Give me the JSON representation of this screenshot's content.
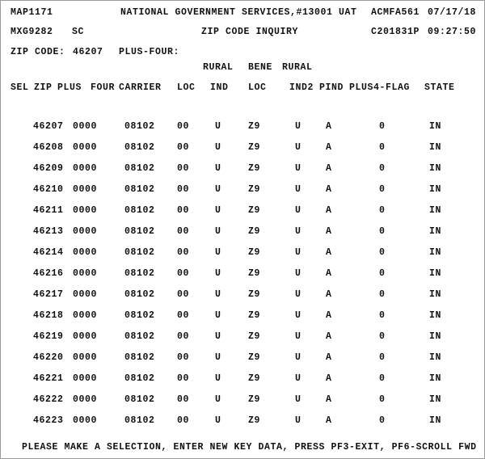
{
  "header": {
    "map_id": "MAP1171",
    "center_title": "NATIONAL GOVERNMENT SERVICES,#13001 UAT",
    "program_id": "ACMFA561",
    "run_date": "07/17/18",
    "txn_id": "MXG9282",
    "region_code": "SC",
    "screen_title": "ZIP CODE INQUIRY",
    "terminal_id": "C201831P",
    "run_time": "09:27:50"
  },
  "key_fields": {
    "zip_label": "ZIP CODE:",
    "zip_value": "46207",
    "plusfour_label": "PLUS-FOUR:",
    "plusfour_value": ""
  },
  "column_headers": {
    "top_line": {
      "rural_1": "RURAL",
      "bene": "BENE",
      "rural_2": "RURAL"
    },
    "main_line": {
      "sel": "SEL",
      "zip": "ZIP",
      "plus": "PLUS",
      "four": "FOUR",
      "carrier": "CARRIER",
      "loc": "LOC",
      "rural_ind": "IND",
      "bene_loc": "LOC",
      "rural_ind2": "IND2",
      "pind": "PIND",
      "plus4_flag": "PLUS4-FLAG",
      "state": "STATE"
    }
  },
  "rows": [
    {
      "sel": "",
      "zip": "46207",
      "plus": "0000",
      "four": "",
      "carrier": "08102",
      "loc": "00",
      "rural_ind": "U",
      "bene_loc": "Z9",
      "rural_ind2": "U",
      "pind": "A",
      "plus4_flag": "0",
      "state": "IN"
    },
    {
      "sel": "",
      "zip": "46208",
      "plus": "0000",
      "four": "",
      "carrier": "08102",
      "loc": "00",
      "rural_ind": "U",
      "bene_loc": "Z9",
      "rural_ind2": "U",
      "pind": "A",
      "plus4_flag": "0",
      "state": "IN"
    },
    {
      "sel": "",
      "zip": "46209",
      "plus": "0000",
      "four": "",
      "carrier": "08102",
      "loc": "00",
      "rural_ind": "U",
      "bene_loc": "Z9",
      "rural_ind2": "U",
      "pind": "A",
      "plus4_flag": "0",
      "state": "IN"
    },
    {
      "sel": "",
      "zip": "46210",
      "plus": "0000",
      "four": "",
      "carrier": "08102",
      "loc": "00",
      "rural_ind": "U",
      "bene_loc": "Z9",
      "rural_ind2": "U",
      "pind": "A",
      "plus4_flag": "0",
      "state": "IN"
    },
    {
      "sel": "",
      "zip": "46211",
      "plus": "0000",
      "four": "",
      "carrier": "08102",
      "loc": "00",
      "rural_ind": "U",
      "bene_loc": "Z9",
      "rural_ind2": "U",
      "pind": "A",
      "plus4_flag": "0",
      "state": "IN"
    },
    {
      "sel": "",
      "zip": "46213",
      "plus": "0000",
      "four": "",
      "carrier": "08102",
      "loc": "00",
      "rural_ind": "U",
      "bene_loc": "Z9",
      "rural_ind2": "U",
      "pind": "A",
      "plus4_flag": "0",
      "state": "IN"
    },
    {
      "sel": "",
      "zip": "46214",
      "plus": "0000",
      "four": "",
      "carrier": "08102",
      "loc": "00",
      "rural_ind": "U",
      "bene_loc": "Z9",
      "rural_ind2": "U",
      "pind": "A",
      "plus4_flag": "0",
      "state": "IN"
    },
    {
      "sel": "",
      "zip": "46216",
      "plus": "0000",
      "four": "",
      "carrier": "08102",
      "loc": "00",
      "rural_ind": "U",
      "bene_loc": "Z9",
      "rural_ind2": "U",
      "pind": "A",
      "plus4_flag": "0",
      "state": "IN"
    },
    {
      "sel": "",
      "zip": "46217",
      "plus": "0000",
      "four": "",
      "carrier": "08102",
      "loc": "00",
      "rural_ind": "U",
      "bene_loc": "Z9",
      "rural_ind2": "U",
      "pind": "A",
      "plus4_flag": "0",
      "state": "IN"
    },
    {
      "sel": "",
      "zip": "46218",
      "plus": "0000",
      "four": "",
      "carrier": "08102",
      "loc": "00",
      "rural_ind": "U",
      "bene_loc": "Z9",
      "rural_ind2": "U",
      "pind": "A",
      "plus4_flag": "0",
      "state": "IN"
    },
    {
      "sel": "",
      "zip": "46219",
      "plus": "0000",
      "four": "",
      "carrier": "08102",
      "loc": "00",
      "rural_ind": "U",
      "bene_loc": "Z9",
      "rural_ind2": "U",
      "pind": "A",
      "plus4_flag": "0",
      "state": "IN"
    },
    {
      "sel": "",
      "zip": "46220",
      "plus": "0000",
      "four": "",
      "carrier": "08102",
      "loc": "00",
      "rural_ind": "U",
      "bene_loc": "Z9",
      "rural_ind2": "U",
      "pind": "A",
      "plus4_flag": "0",
      "state": "IN"
    },
    {
      "sel": "",
      "zip": "46221",
      "plus": "0000",
      "four": "",
      "carrier": "08102",
      "loc": "00",
      "rural_ind": "U",
      "bene_loc": "Z9",
      "rural_ind2": "U",
      "pind": "A",
      "plus4_flag": "0",
      "state": "IN"
    },
    {
      "sel": "",
      "zip": "46222",
      "plus": "0000",
      "four": "",
      "carrier": "08102",
      "loc": "00",
      "rural_ind": "U",
      "bene_loc": "Z9",
      "rural_ind2": "U",
      "pind": "A",
      "plus4_flag": "0",
      "state": "IN"
    },
    {
      "sel": "",
      "zip": "46223",
      "plus": "0000",
      "four": "",
      "carrier": "08102",
      "loc": "00",
      "rural_ind": "U",
      "bene_loc": "Z9",
      "rural_ind2": "U",
      "pind": "A",
      "plus4_flag": "0",
      "state": "IN"
    }
  ],
  "footer": {
    "message": "PLEASE MAKE A SELECTION, ENTER NEW KEY DATA, PRESS PF3-EXIT, PF6-SCROLL FWD"
  }
}
